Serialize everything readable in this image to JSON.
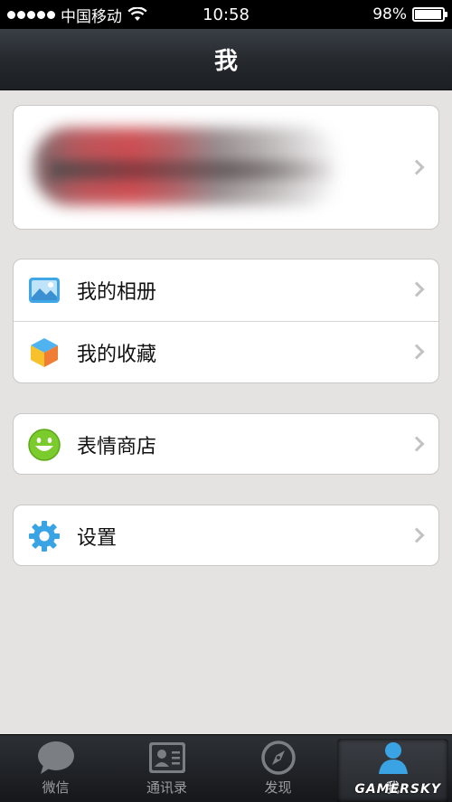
{
  "status_bar": {
    "carrier": "中国移动",
    "time": "10:58",
    "battery_percent": "98%",
    "battery_level": 0.98,
    "icons": [
      "signal-dots-icon",
      "wifi-icon",
      "battery-icon"
    ]
  },
  "nav": {
    "title": "我"
  },
  "profile": {
    "content": "blurred-profile"
  },
  "menu_groups": [
    {
      "items": [
        {
          "label": "我的相册",
          "icon": "photo-album-icon"
        },
        {
          "label": "我的收藏",
          "icon": "favorites-cube-icon"
        }
      ]
    },
    {
      "items": [
        {
          "label": "表情商店",
          "icon": "smiley-face-icon"
        }
      ]
    },
    {
      "items": [
        {
          "label": "设置",
          "icon": "gear-icon"
        }
      ]
    }
  ],
  "tabs": [
    {
      "label": "微信",
      "icon": "chat-bubble-icon",
      "active": false
    },
    {
      "label": "通讯录",
      "icon": "contacts-card-icon",
      "active": false
    },
    {
      "label": "发现",
      "icon": "compass-icon",
      "active": false
    },
    {
      "label": "我",
      "icon": "person-icon",
      "active": true
    }
  ],
  "watermark": "GAMERSKY",
  "colors": {
    "nav_bg": "#24282d",
    "page_bg": "#e4e3e1",
    "accent_blue": "#3aa3e3"
  }
}
